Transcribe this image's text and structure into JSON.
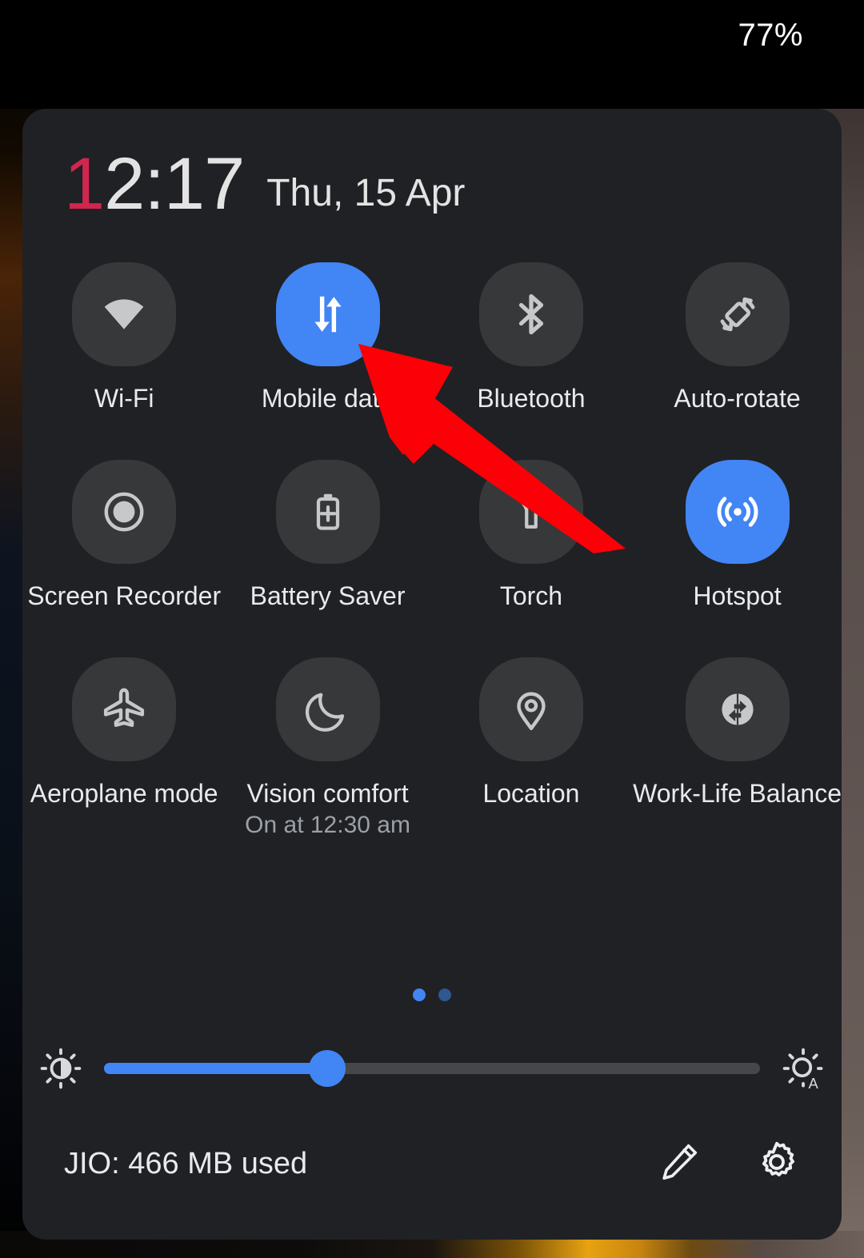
{
  "statusbar": {
    "battery_percent": "77%"
  },
  "panel": {
    "clock": {
      "hour_accent": "1",
      "time_rest": "2:17",
      "full_time": "12:17",
      "date": "Thu, 15 Apr"
    },
    "tiles": [
      {
        "label": "Wi-Fi",
        "sublabel": "",
        "icon": "wifi-icon",
        "active": false
      },
      {
        "label": "Mobile data",
        "sublabel": "",
        "icon": "mobile-data-icon",
        "active": true
      },
      {
        "label": "Bluetooth",
        "sublabel": "",
        "icon": "bluetooth-icon",
        "active": false
      },
      {
        "label": "Auto-rotate",
        "sublabel": "",
        "icon": "auto-rotate-icon",
        "active": false
      },
      {
        "label": "Screen Recorder",
        "sublabel": "",
        "icon": "screen-recorder-icon",
        "active": false
      },
      {
        "label": "Battery Saver",
        "sublabel": "",
        "icon": "battery-saver-icon",
        "active": false
      },
      {
        "label": "Torch",
        "sublabel": "",
        "icon": "torch-icon",
        "active": false
      },
      {
        "label": "Hotspot",
        "sublabel": "",
        "icon": "hotspot-icon",
        "active": true
      },
      {
        "label": "Aeroplane mode",
        "sublabel": "",
        "icon": "aeroplane-icon",
        "active": false
      },
      {
        "label": "Vision comfort",
        "sublabel": "On at 12:30 am",
        "icon": "moon-icon",
        "active": false
      },
      {
        "label": "Location",
        "sublabel": "",
        "icon": "location-pin-icon",
        "active": false
      },
      {
        "label": "Work-Life Balance",
        "sublabel": "",
        "icon": "work-life-icon",
        "active": false
      }
    ],
    "pager": {
      "total_pages": 2,
      "current_page": 1
    },
    "brightness": {
      "value_percent": 34,
      "low_icon": "brightness-low-icon",
      "auto_icon": "brightness-auto-icon"
    },
    "footer": {
      "data_usage": "JIO: 466 MB used",
      "edit_icon": "pencil-edit-icon",
      "settings_icon": "gear-settings-icon"
    }
  },
  "annotation": {
    "arrow": "red-pointer-arrow",
    "points_at": "Mobile data"
  },
  "colors": {
    "accent_blue": "#4285f4",
    "panel_bg": "#202124",
    "tile_bg": "#37383a",
    "text_primary": "#e8eaed",
    "text_secondary": "#9aa0a6",
    "clock_accent": "#d0264f",
    "annotation_red": "#fb0007"
  }
}
